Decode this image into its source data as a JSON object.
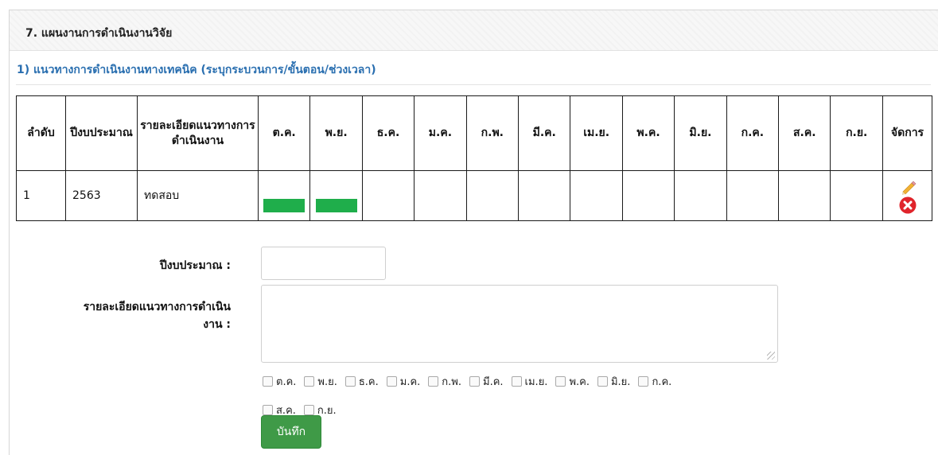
{
  "section": {
    "title": "7. แผนงานการดำเนินงานวิจัย",
    "subtitle": "1) แนวทางการดำเนินงานทางเทคนิค (ระบุกระบวนการ/ขั้นตอน/ช่วงเวลา)"
  },
  "table": {
    "headers": {
      "order": "ลำดับ",
      "budget_year": "ปีงบประมาณ",
      "detail": "รายละเอียดแนวทางการดำเนินงาน",
      "manage": "จัดการ"
    },
    "months": [
      "ต.ค.",
      "พ.ย.",
      "ธ.ค.",
      "ม.ค.",
      "ก.พ.",
      "มี.ค.",
      "เม.ย.",
      "พ.ค.",
      "มิ.ย.",
      "ก.ค.",
      "ส.ค.",
      "ก.ย."
    ],
    "rows": [
      {
        "order": "1",
        "budget_year": "2563",
        "detail": "ทดสอบ",
        "active_months": [
          "ต.ค.",
          "พ.ย."
        ]
      }
    ],
    "bar_color": "#1fae4b",
    "actions": [
      "pencil-icon",
      "delete-icon"
    ]
  },
  "form": {
    "budget_year_label": "ปีงบประมาณ :",
    "budget_year_value": "",
    "detail_label_line1": "รายละเอียดแนวทางการดำเนิน",
    "detail_label_line2": "งาน :",
    "detail_value": "",
    "month_checkboxes": [
      {
        "label": "ต.ค.",
        "checked": false
      },
      {
        "label": "พ.ย.",
        "checked": false
      },
      {
        "label": "ธ.ค.",
        "checked": false
      },
      {
        "label": "ม.ค.",
        "checked": false
      },
      {
        "label": "ก.พ.",
        "checked": false
      },
      {
        "label": "มี.ค.",
        "checked": false
      },
      {
        "label": "เม.ย.",
        "checked": false
      },
      {
        "label": "พ.ค.",
        "checked": false
      },
      {
        "label": "มิ.ย.",
        "checked": false
      },
      {
        "label": "ก.ค.",
        "checked": false
      },
      {
        "label": "ส.ค.",
        "checked": false
      },
      {
        "label": "ก.ย.",
        "checked": false
      }
    ],
    "save_label": "บันทึก",
    "save_color": "#3f9a47"
  },
  "colors": {
    "subtitle": "#2a6fb0",
    "delete_icon": "#e0242b"
  }
}
